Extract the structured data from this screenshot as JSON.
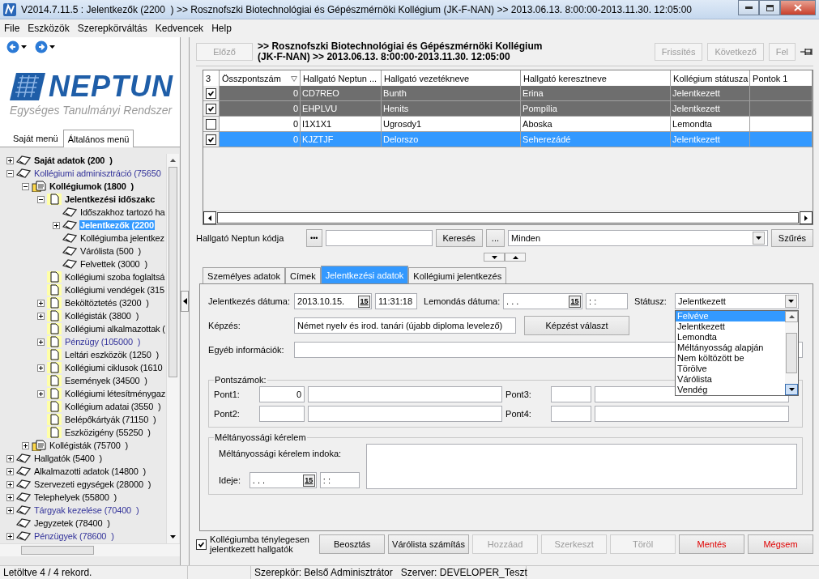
{
  "window": {
    "title": "V2014.7.11.5 : Jelentkezők (2200  ) >> Rosznofszki Biotechnológiai és Gépészmérnöki Kollégium (JK-F-NAN) >> 2013.06.13. 8:00:00-2013.11.30. 12:05:00"
  },
  "menu": [
    "File",
    "Eszközök",
    "Szerepkörváltás",
    "Kedvencek",
    "Help"
  ],
  "logo": {
    "name": "NEPTUN",
    "tagline": "Egységes Tanulmányi Rendszer"
  },
  "side_tabs": [
    {
      "label": "Saját menü",
      "selected": false
    },
    {
      "label": "Általános menü",
      "selected": true
    }
  ],
  "tree": [
    {
      "label": "Saját adatok (200  )",
      "kind": "book",
      "bold": true,
      "link": false,
      "expanded": false,
      "selected": false
    },
    {
      "label": "Kollégiumi adminisztráció (75650",
      "kind": "book",
      "bold": false,
      "link": true,
      "expanded": true,
      "selected": false,
      "children": [
        {
          "label": "Kollégiumok (1800  )",
          "kind": "folder",
          "bold": true,
          "link": false,
          "expanded": true,
          "selected": false,
          "children": [
            {
              "label": "Jelentkezési időszakc",
              "kind": "doc",
              "bold": true,
              "link": false,
              "expanded": true,
              "selected": false,
              "children": [
                {
                  "label": "Időszakhoz tartozó ha",
                  "kind": "book",
                  "bold": false,
                  "link": false,
                  "selected": false
                },
                {
                  "label": "Jelentkezők (2200",
                  "kind": "book",
                  "bold": false,
                  "link": false,
                  "expanded": false,
                  "selected": true
                },
                {
                  "label": "Kollégiumba jelentkez",
                  "kind": "book",
                  "bold": false,
                  "link": false,
                  "selected": false
                },
                {
                  "label": "Várólista (500  )",
                  "kind": "book",
                  "bold": false,
                  "link": false,
                  "selected": false
                },
                {
                  "label": "Felvettek (3000  )",
                  "kind": "book",
                  "bold": false,
                  "link": false,
                  "selected": false
                }
              ]
            },
            {
              "label": "Kollégiumi szoba foglaltsá",
              "kind": "doc",
              "bold": false,
              "link": false,
              "selected": false
            },
            {
              "label": "Kollégiumi vendégek (315",
              "kind": "doc",
              "bold": false,
              "link": false,
              "selected": false
            },
            {
              "label": "Beköltöztetés (3200  )",
              "kind": "doc",
              "bold": false,
              "link": false,
              "expanded": false,
              "selected": false
            },
            {
              "label": "Kollégisták (3800  )",
              "kind": "doc",
              "bold": false,
              "link": false,
              "expanded": false,
              "selected": false
            },
            {
              "label": "Kollégiumi alkalmazottak (",
              "kind": "doc",
              "bold": false,
              "link": false,
              "selected": false
            },
            {
              "label": "Pénzügy (105000  )",
              "kind": "doc",
              "bold": false,
              "link": true,
              "expanded": false,
              "selected": false
            },
            {
              "label": "Leltári eszközök (1250  )",
              "kind": "doc",
              "bold": false,
              "link": false,
              "selected": false
            },
            {
              "label": "Kollégiumi ciklusok (1610",
              "kind": "doc",
              "bold": false,
              "link": false,
              "expanded": false,
              "selected": false
            },
            {
              "label": "Események (34500  )",
              "kind": "doc",
              "bold": false,
              "link": false,
              "selected": false
            },
            {
              "label": "Kollégiumi létesítménygaz",
              "kind": "doc",
              "bold": false,
              "link": false,
              "expanded": false,
              "selected": false
            },
            {
              "label": "Kollégium adatai (3550  )",
              "kind": "doc",
              "bold": false,
              "link": false,
              "selected": false
            },
            {
              "label": "Belépőkártyák (71150  )",
              "kind": "doc",
              "bold": false,
              "link": false,
              "selected": false
            },
            {
              "label": "Eszközigény (55250  )",
              "kind": "doc",
              "bold": false,
              "link": false,
              "selected": false
            }
          ]
        },
        {
          "label": "Kollégisták (75700  )",
          "kind": "folder",
          "bold": false,
          "link": false,
          "expanded": false,
          "selected": false
        }
      ]
    },
    {
      "label": "Hallgatók (5400  )",
      "kind": "book",
      "bold": false,
      "link": false,
      "expanded": false,
      "selected": false
    },
    {
      "label": "Alkalmazotti adatok (14800  )",
      "kind": "book",
      "bold": false,
      "link": false,
      "expanded": false,
      "selected": false
    },
    {
      "label": "Szervezeti egységek (28000  )",
      "kind": "book",
      "bold": false,
      "link": false,
      "expanded": false,
      "selected": false
    },
    {
      "label": "Telephelyek (55800  )",
      "kind": "book",
      "bold": false,
      "link": false,
      "expanded": false,
      "selected": false
    },
    {
      "label": "Tárgyak kezelése (70400  )",
      "kind": "book",
      "bold": false,
      "link": true,
      "expanded": false,
      "selected": false
    },
    {
      "label": "Jegyzetek (78400  )",
      "kind": "book",
      "bold": false,
      "link": false,
      "selected": false
    },
    {
      "label": "Pénzügyek (78600  )",
      "kind": "book",
      "bold": false,
      "link": true,
      "expanded": false,
      "selected": false
    }
  ],
  "header": {
    "prev": {
      "label": "Előző",
      "disabled": true
    },
    "title_lines": [
      ">> Rosznofszki Biotechnológiai és Gépészmérnöki Kollégium",
      "(JK-F-NAN) >> 2013.06.13. 8:00:00-2013.11.30. 12:05:00"
    ],
    "buttons": [
      {
        "label": "Frissítés",
        "disabled": true
      },
      {
        "label": "Következő",
        "disabled": true
      },
      {
        "label": "Fel",
        "disabled": true
      }
    ]
  },
  "table": {
    "check_column": "3",
    "columns": [
      "Összpontszám",
      "Hallgató Neptun ...",
      "Hallgató vezetékneve",
      "Hallgató keresztneve",
      "Kollégium státusza",
      "Pontok 1"
    ],
    "rows": [
      {
        "checked": true,
        "highlighted": true,
        "selected": false,
        "cells": [
          "0",
          "CD7REO",
          "Bunth",
          "Erina",
          "Jelentkezett"
        ]
      },
      {
        "checked": true,
        "highlighted": true,
        "selected": false,
        "cells": [
          "0",
          "EHPLVU",
          "Henits",
          "Pompília",
          "Jelentkezett"
        ]
      },
      {
        "checked": false,
        "highlighted": false,
        "selected": false,
        "cells": [
          "0",
          "I1X1X1",
          "Ugrosdy1",
          "Aboska",
          "Lemondta"
        ]
      },
      {
        "checked": true,
        "highlighted": false,
        "selected": true,
        "cells": [
          "0",
          "KJZTJF",
          "Delorszo",
          "Seherezádé",
          "Jelentkezett"
        ]
      }
    ]
  },
  "search": {
    "label": "Hallgató Neptun kódja",
    "picker": "•••",
    "search_button": "Keresés",
    "more_button": "...",
    "filter": "Minden",
    "filter_button": "Szűrés"
  },
  "detail_tabs": [
    {
      "label": "Személyes adatok",
      "selected": false
    },
    {
      "label": "Címek",
      "selected": false
    },
    {
      "label": "Jelentkezési adatok",
      "selected": true
    },
    {
      "label": "Kollégiumi jelentkezés",
      "selected": false
    }
  ],
  "form": {
    "reg_label": "Jelentkezés dátuma:",
    "reg": {
      "date": "2013.10.15.",
      "button": "15",
      "time": "11:31:18"
    },
    "cancel_label": "Lemondás dátuma:",
    "cancel": {
      "date": ". . .",
      "button": "15",
      "time": ": :"
    },
    "status_label": "Státusz:",
    "status": "Jelentkezett",
    "status_options": [
      {
        "label": "Felvéve",
        "selected": true
      },
      {
        "label": "Jelentkezett",
        "selected": false
      },
      {
        "label": "Lemondta",
        "selected": false
      },
      {
        "label": "Méltányosság alapján",
        "selected": false
      },
      {
        "label": "Nem költözött be",
        "selected": false
      },
      {
        "label": "Törölve",
        "selected": false
      },
      {
        "label": "Várólista",
        "selected": false
      },
      {
        "label": "Vendég",
        "selected": false
      }
    ],
    "training_label": "Képzés:",
    "training": "Német nyelv és irod. tanári (újabb diploma levelező)",
    "training_button": "Képzést választ",
    "other_label": "Egyéb információk:"
  },
  "points": {
    "legend": "Pontszámok:",
    "items": [
      {
        "label": "Pont1:",
        "value": "0"
      },
      {
        "label": "Pont3:"
      },
      {
        "label": "Pont2:"
      },
      {
        "label": "Pont4:"
      }
    ]
  },
  "equity": {
    "legend": "Méltányossági kérelem",
    "reason_label": "Méltányossági kérelem indoka:",
    "time_label": "Ideje:",
    "when": {
      "date": ". . .",
      "button": "15",
      "time": ": :"
    }
  },
  "footer": {
    "checkbox": {
      "label": "Kollégiumba ténylegesen jelentkezett hallgatók",
      "checked": true
    },
    "buttons": [
      {
        "label": "Beosztás",
        "disabled": false,
        "kind": "normal"
      },
      {
        "label": "Várólista számítás",
        "disabled": false,
        "kind": "normal"
      },
      {
        "label": "Hozzáad",
        "disabled": true,
        "kind": "normal"
      },
      {
        "label": "Szerkeszt",
        "disabled": true,
        "kind": "normal"
      },
      {
        "label": "Töröl",
        "disabled": true,
        "kind": "normal"
      },
      {
        "label": "Mentés",
        "disabled": false,
        "kind": "danger"
      },
      {
        "label": "Mégsem",
        "disabled": false,
        "kind": "danger"
      }
    ]
  },
  "status_bar": [
    "Letöltve 4 / 4 rekord.",
    "Szerepkör: Belső Adminisztrátor   Szerver: DEVELOPER_Teszt"
  ]
}
